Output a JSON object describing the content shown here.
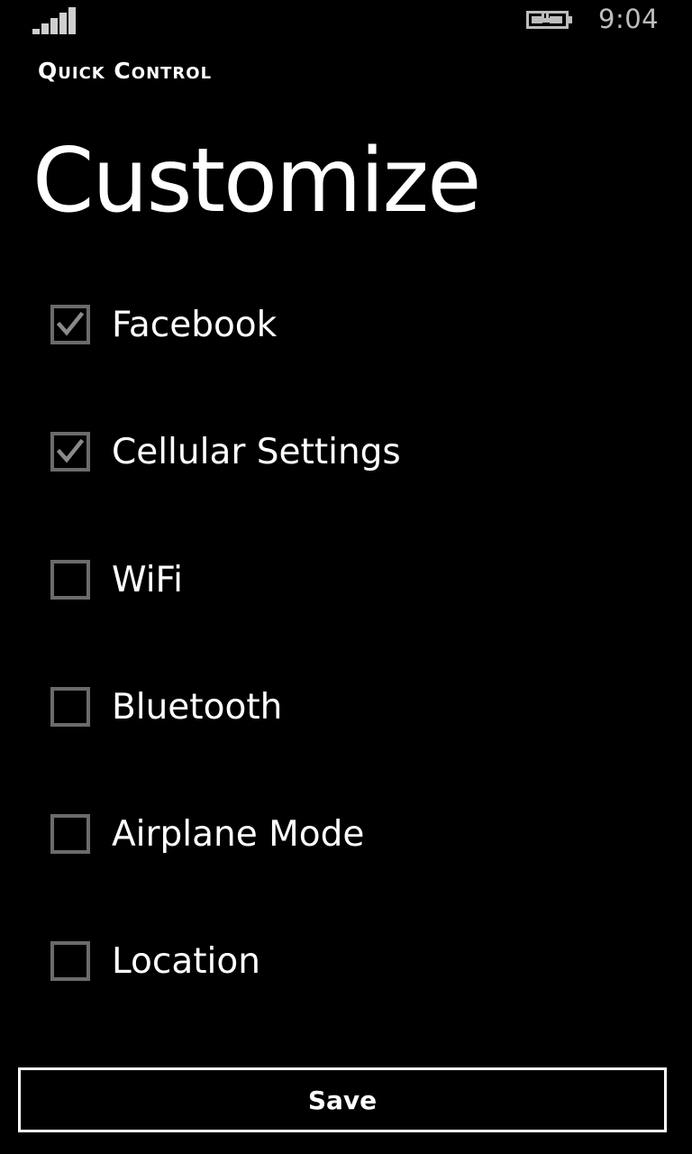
{
  "status_bar": {
    "time": "9:04",
    "signal_icon": "signal-strength-icon",
    "battery_icon": "battery-charging-icon"
  },
  "app": {
    "title": "Quick Control"
  },
  "page": {
    "title": "Customize"
  },
  "options": [
    {
      "label": "Facebook",
      "checked": true
    },
    {
      "label": "Cellular Settings",
      "checked": true
    },
    {
      "label": "WiFi",
      "checked": false
    },
    {
      "label": "Bluetooth",
      "checked": false
    },
    {
      "label": "Airplane Mode",
      "checked": false
    },
    {
      "label": "Location",
      "checked": false
    }
  ],
  "save_button": {
    "label": "Save"
  },
  "colors": {
    "background": "#000000",
    "text": "#ffffff",
    "checkbox_border": "#6b6b6b",
    "checkmark": "#8a8a8a",
    "status_text": "#bdbdbd"
  }
}
